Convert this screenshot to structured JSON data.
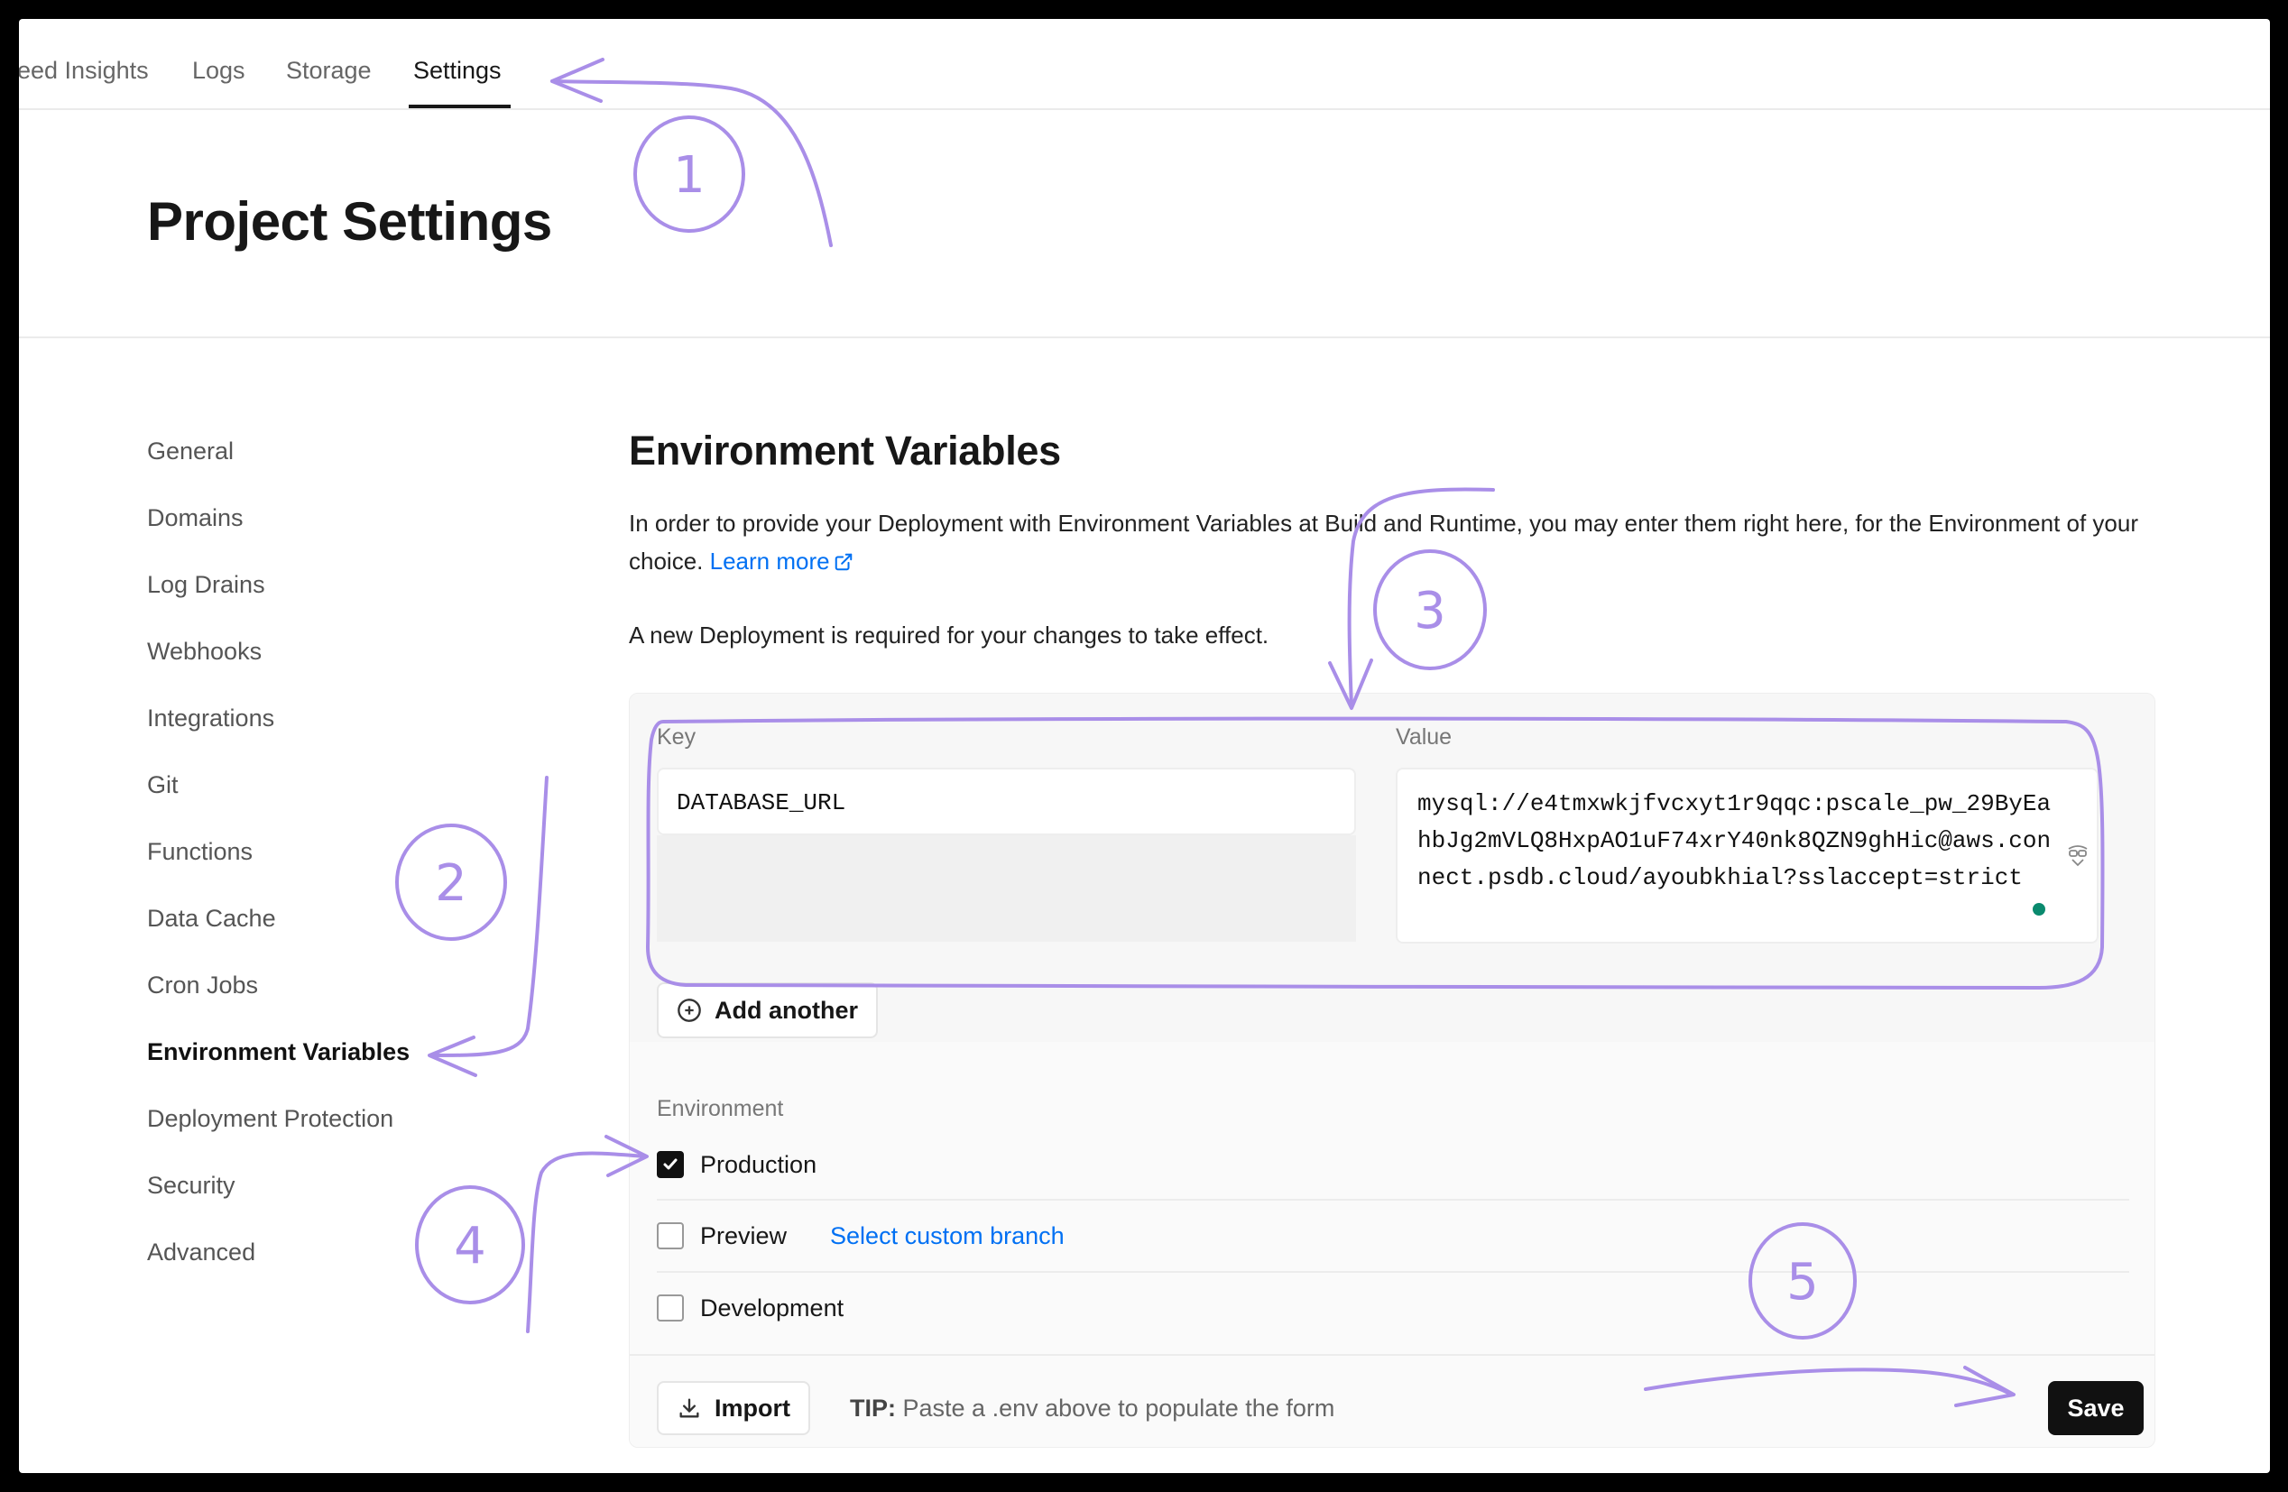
{
  "tabs": [
    {
      "label": "eed Insights"
    },
    {
      "label": "Logs"
    },
    {
      "label": "Storage"
    },
    {
      "label": "Settings"
    }
  ],
  "page_title": "Project Settings",
  "sidebar": {
    "items": [
      {
        "label": "General"
      },
      {
        "label": "Domains"
      },
      {
        "label": "Log Drains"
      },
      {
        "label": "Webhooks"
      },
      {
        "label": "Integrations"
      },
      {
        "label": "Git"
      },
      {
        "label": "Functions"
      },
      {
        "label": "Data Cache"
      },
      {
        "label": "Cron Jobs"
      },
      {
        "label": "Environment Variables",
        "active": true
      },
      {
        "label": "Deployment Protection"
      },
      {
        "label": "Security"
      },
      {
        "label": "Advanced"
      }
    ]
  },
  "main": {
    "title": "Environment Variables",
    "description": "In order to provide your Deployment with Environment Variables at Build and Runtime, you may enter them right here, for the Environment of your choice.",
    "learn_more": "Learn more",
    "notice": "A new Deployment is required for your changes to take effect.",
    "form": {
      "key_label": "Key",
      "value_label": "Value",
      "key_value": "DATABASE_URL",
      "value_value": "mysql://e4tmxwkjfvcxyt1r9qqc:pscale_pw_29ByEahbJg2mVLQ8HxpAO1uF74xrY40nk8QZN9ghHic@aws.connect.psdb.cloud/ayoubkhial?sslaccept=strict",
      "add_another": "Add another"
    },
    "environment": {
      "label": "Environment",
      "options": [
        {
          "label": "Production",
          "checked": true
        },
        {
          "label": "Preview",
          "checked": false
        },
        {
          "label": "Development",
          "checked": false
        }
      ],
      "custom_branch": "Select custom branch"
    },
    "footer": {
      "import_label": "Import",
      "tip_prefix": "TIP:",
      "tip_text": "Paste a .env above to populate the form",
      "save_label": "Save"
    }
  },
  "annotations": [
    "1",
    "2",
    "3",
    "4",
    "5"
  ],
  "colors": {
    "accent_link": "#0070f3",
    "annotation": "#a98ee8",
    "save_button": "#111111"
  }
}
